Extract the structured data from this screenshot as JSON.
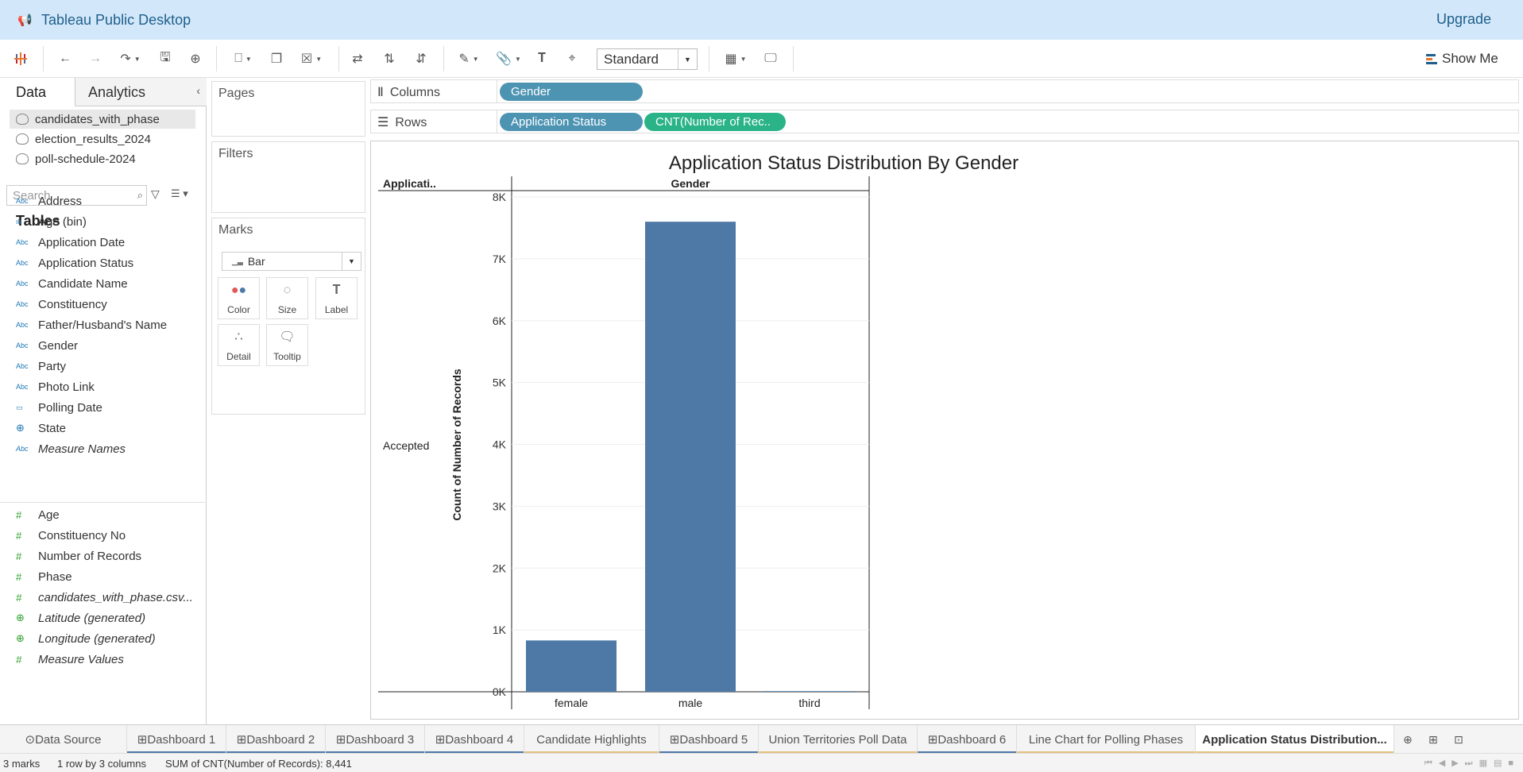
{
  "window": {
    "title": "Tableau Public Desktop",
    "upgrade": "Upgrade"
  },
  "toolbar": {
    "fit_value": "Standard",
    "show_me": "Show Me"
  },
  "left_panel": {
    "tabs": [
      "Data",
      "Analytics"
    ],
    "datasources": [
      "candidates_with_phase",
      "election_results_2024",
      "poll-schedule-2024"
    ],
    "search_placeholder": "Search",
    "tables_heading": "Tables",
    "dimensions": [
      {
        "type": "Abc",
        "name": "Address"
      },
      {
        "type": "bin",
        "name": "Age (bin)"
      },
      {
        "type": "Abc",
        "name": "Application Date"
      },
      {
        "type": "Abc",
        "name": "Application Status"
      },
      {
        "type": "Abc",
        "name": "Candidate Name"
      },
      {
        "type": "Abc",
        "name": "Constituency"
      },
      {
        "type": "Abc",
        "name": "Father/Husband's Name"
      },
      {
        "type": "Abc",
        "name": "Gender"
      },
      {
        "type": "Abc",
        "name": "Party"
      },
      {
        "type": "Abc",
        "name": "Photo Link"
      },
      {
        "type": "date",
        "name": "Polling Date"
      },
      {
        "type": "geo",
        "name": "State"
      },
      {
        "type": "Abc",
        "name": "Measure Names"
      }
    ],
    "measures": [
      {
        "type": "#",
        "name": "Age"
      },
      {
        "type": "#",
        "name": "Constituency No"
      },
      {
        "type": "#",
        "name": "Number of Records"
      },
      {
        "type": "#",
        "name": "Phase"
      },
      {
        "type": "#",
        "name": "candidates_with_phase.csv..."
      },
      {
        "type": "geo",
        "name": "Latitude (generated)"
      },
      {
        "type": "geo",
        "name": "Longitude (generated)"
      },
      {
        "type": "#",
        "name": "Measure Values"
      }
    ]
  },
  "cards": {
    "pages": "Pages",
    "filters": "Filters",
    "marks": "Marks",
    "mark_type": "Bar",
    "mark_buttons": [
      "Color",
      "Size",
      "Label",
      "Detail",
      "Tooltip"
    ]
  },
  "shelves": {
    "columns_label": "Columns",
    "rows_label": "Rows",
    "columns_pills": [
      "Gender"
    ],
    "rows_pills": [
      "Application Status",
      "CNT(Number of Rec.."
    ]
  },
  "chart_data": {
    "type": "bar",
    "title": "Application Status Distribution By Gender",
    "row_header": "Applicati..",
    "column_header": "Gender",
    "row_value": "Accepted",
    "ylabel": "Count of Number of Records",
    "categories": [
      "female",
      "male",
      "third"
    ],
    "values": [
      830,
      7600,
      11
    ],
    "ylim": [
      0,
      8000
    ],
    "yticks": [
      {
        "v": 0,
        "l": "0K"
      },
      {
        "v": 1000,
        "l": "1K"
      },
      {
        "v": 2000,
        "l": "2K"
      },
      {
        "v": 3000,
        "l": "3K"
      },
      {
        "v": 4000,
        "l": "4K"
      },
      {
        "v": 5000,
        "l": "5K"
      },
      {
        "v": 6000,
        "l": "6K"
      },
      {
        "v": 7000,
        "l": "7K"
      },
      {
        "v": 8000,
        "l": "8K"
      }
    ],
    "bar_color": "#4e79a7",
    "grid": true
  },
  "sheet_tabs": [
    {
      "label": "Data Source",
      "kind": "ds",
      "accent": ""
    },
    {
      "label": "Dashboard 1",
      "kind": "dash",
      "accent": "#4e79a7"
    },
    {
      "label": "Dashboard 2",
      "kind": "dash",
      "accent": "#4e79a7"
    },
    {
      "label": "Dashboard 3",
      "kind": "dash",
      "accent": "#4e79a7"
    },
    {
      "label": "Dashboard 4",
      "kind": "dash",
      "accent": "#4e79a7"
    },
    {
      "label": "Candidate Highlights",
      "kind": "sheet",
      "accent": "#e4c17e"
    },
    {
      "label": "Dashboard 5",
      "kind": "dash",
      "accent": "#4e79a7"
    },
    {
      "label": "Union Territories Poll Data",
      "kind": "sheet",
      "accent": "#e4c17e"
    },
    {
      "label": "Dashboard 6",
      "kind": "dash",
      "accent": "#4e79a7"
    },
    {
      "label": "Line Chart for Polling Phases",
      "kind": "sheet",
      "accent": "#e4c17e"
    },
    {
      "label": "Application Status Distribution...",
      "kind": "sheet",
      "accent": "#e4c17e",
      "active": true
    }
  ],
  "status": {
    "marks": "3 marks",
    "dims": "1 row by 3 columns",
    "sum": "SUM of CNT(Number of Records): 8,441"
  }
}
